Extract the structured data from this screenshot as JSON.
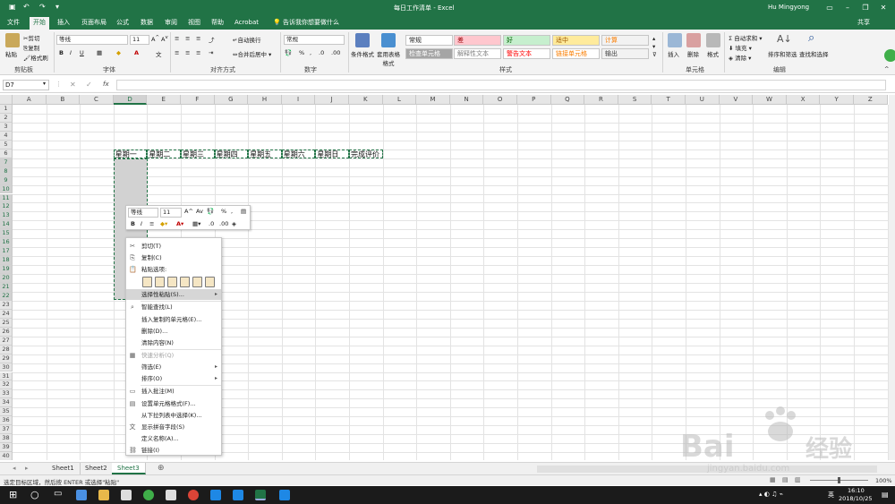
{
  "window": {
    "title": "每日工作清单 - Excel",
    "user": "Hu Mingyong",
    "share": "共享",
    "tell_me": "告诉我你想要做什么"
  },
  "tabs": [
    "文件",
    "开始",
    "插入",
    "页面布局",
    "公式",
    "数据",
    "审阅",
    "视图",
    "帮助",
    "Acrobat"
  ],
  "ribbon": {
    "clipboard": {
      "paste": "粘贴",
      "cut": "剪切",
      "copy": "复制",
      "format_painter": "格式刷",
      "label": "剪贴板"
    },
    "font": {
      "name": "等线",
      "size": "11",
      "label": "字体"
    },
    "alignment": {
      "wrap": "自动换行",
      "merge": "合并后居中",
      "label": "对齐方式"
    },
    "number": {
      "format": "常规",
      "label": "数字"
    },
    "styles": {
      "conditional": "条件格式",
      "table": "套用表格格式",
      "items": [
        {
          "text": "常规",
          "bg": "#ffffff",
          "fg": "#222222"
        },
        {
          "text": "差",
          "bg": "#ffc7ce",
          "fg": "#9c0006"
        },
        {
          "text": "好",
          "bg": "#c6efce",
          "fg": "#006100"
        },
        {
          "text": "适中",
          "bg": "#ffeb9c",
          "fg": "#9c5700"
        },
        {
          "text": "计算",
          "bg": "#f2f2f2",
          "fg": "#fa7d00"
        },
        {
          "text": "检查单元格",
          "bg": "#a5a5a5",
          "fg": "#ffffff"
        },
        {
          "text": "解释性文本",
          "bg": "#ffffff",
          "fg": "#7f7f7f"
        },
        {
          "text": "警告文本",
          "bg": "#ffffff",
          "fg": "#ff0000"
        },
        {
          "text": "链接单元格",
          "bg": "#ffffff",
          "fg": "#fa7d00"
        },
        {
          "text": "输出",
          "bg": "#f2f2f2",
          "fg": "#3f3f3f"
        }
      ],
      "label": "样式"
    },
    "cells": {
      "insert": "插入",
      "delete": "删除",
      "format": "格式",
      "label": "单元格"
    },
    "editing": {
      "autosum": "自动求和",
      "fill": "填充",
      "clear": "清除",
      "sort": "排序和筛选",
      "find": "查找和选择",
      "label": "编辑"
    }
  },
  "formula_bar": {
    "name_box": "D7",
    "fx": "fx"
  },
  "columns": [
    "A",
    "B",
    "C",
    "D",
    "E",
    "F",
    "G",
    "H",
    "I",
    "J",
    "K",
    "L",
    "M",
    "N",
    "O",
    "P",
    "Q",
    "R",
    "S",
    "T",
    "U",
    "V",
    "W",
    "X",
    "Y",
    "Z"
  ],
  "rows": [
    "1",
    "2",
    "3",
    "4",
    "5",
    "6",
    "7",
    "8",
    "9",
    "10",
    "11",
    "12",
    "13",
    "14",
    "15",
    "16",
    "17",
    "18",
    "19",
    "20",
    "21",
    "22",
    "23",
    "24",
    "25",
    "26",
    "27",
    "28",
    "29",
    "30",
    "31",
    "32",
    "33",
    "34",
    "35",
    "36",
    "37",
    "38",
    "39",
    "40"
  ],
  "row6_cells": [
    "星期一",
    "星期二",
    "星期三",
    "星期四",
    "星期五",
    "星期六",
    "星期日",
    "完成评价"
  ],
  "mini_toolbar": {
    "font": "等线",
    "size": "11"
  },
  "context_menu": [
    {
      "label": "剪切(T)",
      "icon": "✂",
      "disabled": false
    },
    {
      "label": "复制(C)",
      "icon": "⎘",
      "disabled": false
    },
    {
      "label": "粘贴选项:",
      "icon": "📋",
      "disabled": false
    },
    {
      "label": "选择性粘贴(S)...",
      "icon": "",
      "disabled": false,
      "highlight": true,
      "submenu": true
    },
    {
      "label": "智能查找(L)",
      "icon": "⌕",
      "disabled": false
    },
    {
      "label": "插入复制的单元格(E)...",
      "icon": "",
      "disabled": false
    },
    {
      "label": "删除(D)...",
      "icon": "",
      "disabled": false
    },
    {
      "label": "清除内容(N)",
      "icon": "",
      "disabled": false
    },
    {
      "label": "快速分析(Q)",
      "icon": "▦",
      "disabled": true
    },
    {
      "label": "筛选(E)",
      "icon": "",
      "disabled": false,
      "submenu": true
    },
    {
      "label": "排序(O)",
      "icon": "",
      "disabled": false,
      "submenu": true
    },
    {
      "label": "插入批注(M)",
      "icon": "▭",
      "disabled": false
    },
    {
      "label": "设置单元格格式(F)...",
      "icon": "▤",
      "disabled": false
    },
    {
      "label": "从下拉列表中选择(K)...",
      "icon": "",
      "disabled": false
    },
    {
      "label": "显示拼音字段(S)",
      "icon": "文",
      "disabled": false
    },
    {
      "label": "定义名称(A)...",
      "icon": "",
      "disabled": false
    },
    {
      "label": "链接(I)",
      "icon": "⛓",
      "disabled": false
    }
  ],
  "sheets": [
    "Sheet1",
    "Sheet2",
    "Sheet3"
  ],
  "status": {
    "text": "选定目标区域，然后按 ENTER 或选择\"粘贴\"",
    "zoom": "100%"
  },
  "clock": {
    "time": "16:10",
    "date": "2018/10/25"
  },
  "ime": "英",
  "colors": {
    "accent": "#217346",
    "selection": "#d2d2d2"
  }
}
